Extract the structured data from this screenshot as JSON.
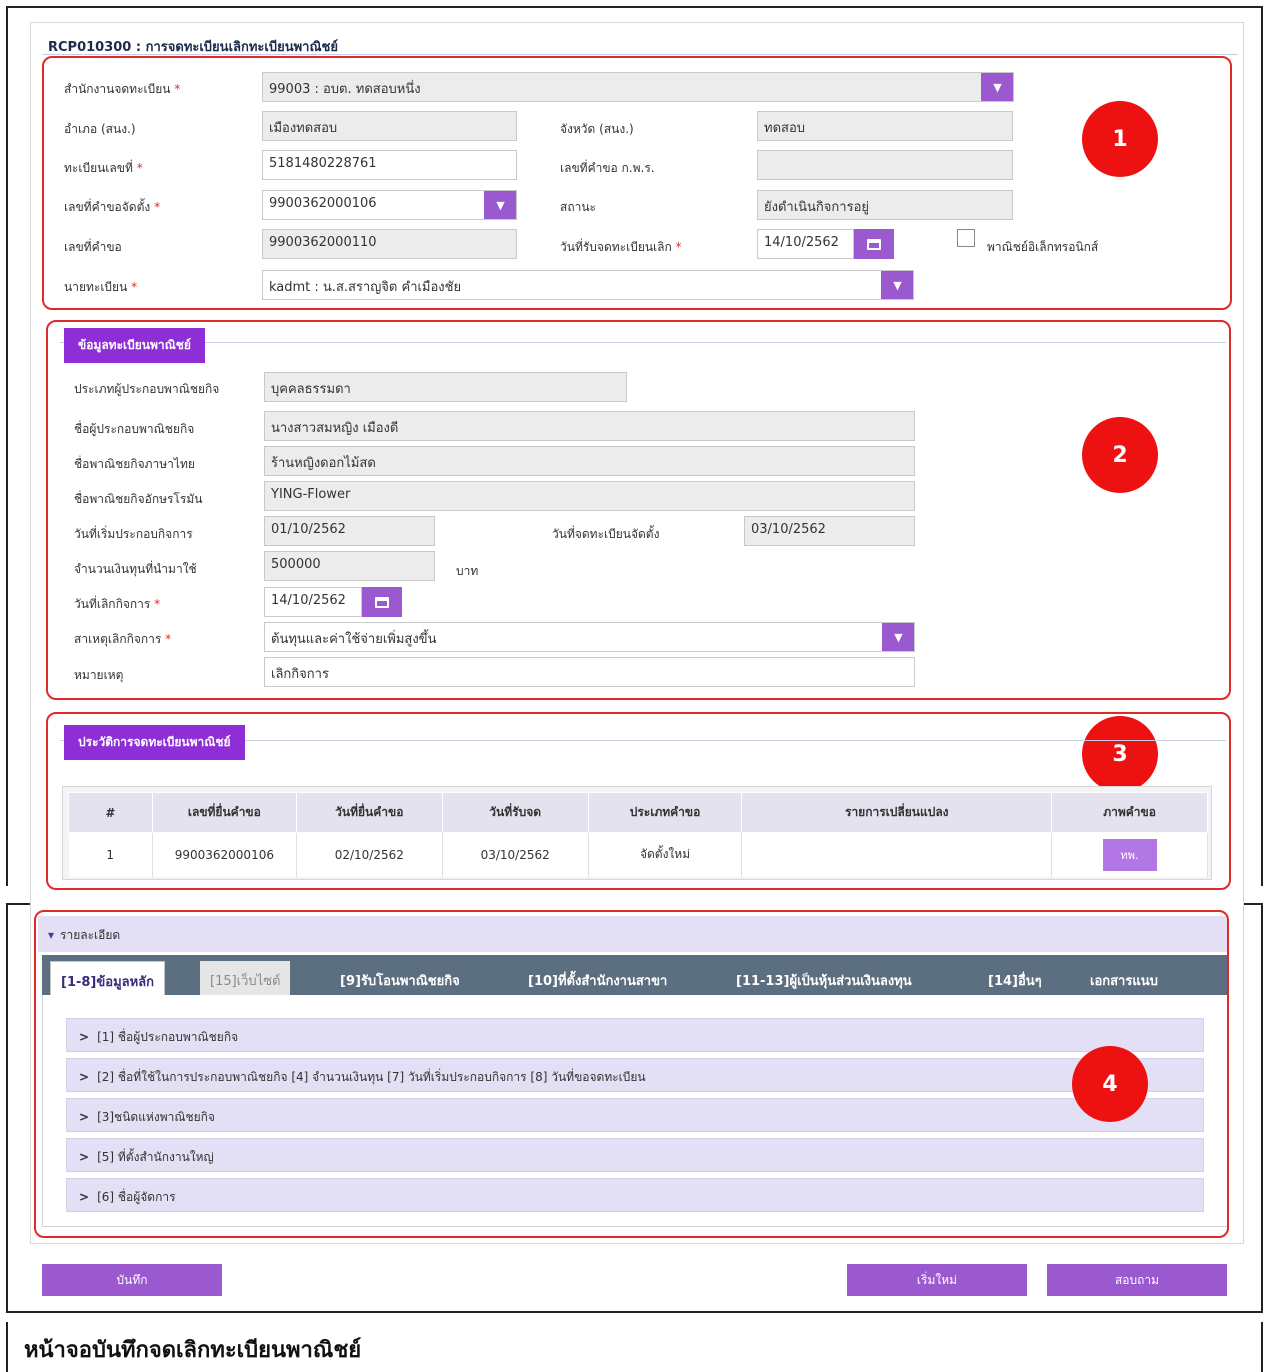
{
  "page": {
    "title": "RCP010300 : การจดทะเบียนเลิกทะเบียนพาณิชย์",
    "caption": "หน้าจอบันทึกจดเลิกทะเบียนพาณิชย์"
  },
  "callouts": [
    "1",
    "2",
    "3",
    "4"
  ],
  "section1": {
    "office_label": "สำนักงานจดทะเบียน",
    "office_value": "99003 : อบต. ทดสอบหนึ่ง",
    "amphoe_label": "อำเภอ (สนง.)",
    "amphoe_value": "เมืองทดสอบ",
    "province_label": "จังหวัด (สนง.)",
    "province_value": "ทดสอบ",
    "regno_label": "ทะเบียนเลขที่",
    "regno_value": "5181480228761",
    "kps_label": "เลขที่คำขอ ก.พ.ร.",
    "kps_value": "",
    "setup_req_label": "เลขที่คำขอจัดตั้ง",
    "setup_req_value": "9900362000106",
    "status_label": "สถานะ",
    "status_value": "ยังดำเนินกิจการอยู่",
    "req_no_label": "เลขที่คำขอ",
    "req_no_value": "9900362000110",
    "recv_date_label": "วันที่รับจดทะเบียนเลิก",
    "recv_date_value": "14/10/2562",
    "ecommerce_label": "พาณิชย์อิเล็กทรอนิกส์",
    "registrar_label": "นายทะเบียน",
    "registrar_value": "kadmt : น.ส.สราญจิต คำเมืองชัย",
    "required_mark": "*"
  },
  "section2": {
    "tab_label": "ข้อมูลทะเบียนพาณิชย์",
    "owner_type_label": "ประเภทผู้ประกอบพาณิชยกิจ",
    "owner_type_value": "บุคคลธรรมดา",
    "owner_name_label": "ชื่อผู้ประกอบพาณิชยกิจ",
    "owner_name_value": "นางสาวสมหญิง เมืองดี",
    "thai_name_label": "ชื่อพาณิชยกิจภาษาไทย",
    "thai_name_value": "ร้านหญิงดอกไม้สด",
    "roman_name_label": "ชื่อพาณิชยกิจอักษรโรมัน",
    "roman_name_value": "YING-Flower",
    "start_date_label": "วันที่เริ่มประกอบกิจการ",
    "start_date_value": "01/10/2562",
    "setup_date_label": "วันที่จดทะเบียนจัดตั้ง",
    "setup_date_value": "03/10/2562",
    "capital_label": "จำนวนเงินทุนที่นำมาใช้",
    "capital_value": "500000",
    "capital_unit": "บาท",
    "close_date_label": "วันที่เลิกกิจการ",
    "close_date_value": "14/10/2562",
    "reason_label": "สาเหตุเลิกกิจการ",
    "reason_value": "ต้นทุนและค่าใช้จ่ายเพิ่มสูงขึ้น",
    "remark_label": "หมายเหตุ",
    "remark_value": "เลิกกิจการ"
  },
  "section3": {
    "tab_label": "ประวัติการจดทะเบียนพาณิชย์",
    "columns": [
      "#",
      "เลขที่ยื่นคำขอ",
      "วันที่ยื่นคำขอ",
      "วันที่รับจด",
      "ประเภทคำขอ",
      "รายการเปลี่ยนแปลง",
      "ภาพคำขอ"
    ],
    "rows": [
      {
        "no": "1",
        "req_no": "9900362000106",
        "submit_date": "02/10/2562",
        "recv_date": "03/10/2562",
        "req_type": "จัดตั้งใหม่",
        "changes": "",
        "image_btn": "ทพ."
      }
    ]
  },
  "section4": {
    "header_label": "รายละเอียด",
    "tabs": [
      "[1-8]ข้อมูลหลัก",
      "[15]เว็บไซต์",
      "[9]รับโอนพาณิชยกิจ",
      "[10]ที่ตั้งสำนักงานสาขา",
      "[11-13]ผู้เป็นหุ้นส่วนเงินลงทุน",
      "[14]อื่นๆ",
      "เอกสารแนบ"
    ],
    "accordion": [
      "[1] ชื่อผู้ประกอบพาณิชยกิจ",
      "[2] ชื่อที่ใช้ในการประกอบพาณิชยกิจ [4] จำนวนเงินทุน [7] วันที่เริ่มประกอบกิจการ [8] วันที่ขอจดทะเบียน",
      "[3]ชนิดแห่งพาณิชยกิจ",
      "[5] ที่ตั้งสำนักงานใหญ่",
      "[6] ชื่อผู้จัดการ"
    ]
  },
  "actions": {
    "save_label": "บันทึก",
    "reset_label": "เริ่มใหม่",
    "inquiry_label": "สอบถาม"
  },
  "colors": {
    "accent": "#9b59d0",
    "callout": "#ee1111",
    "highlight_border": "#e02a2a"
  }
}
